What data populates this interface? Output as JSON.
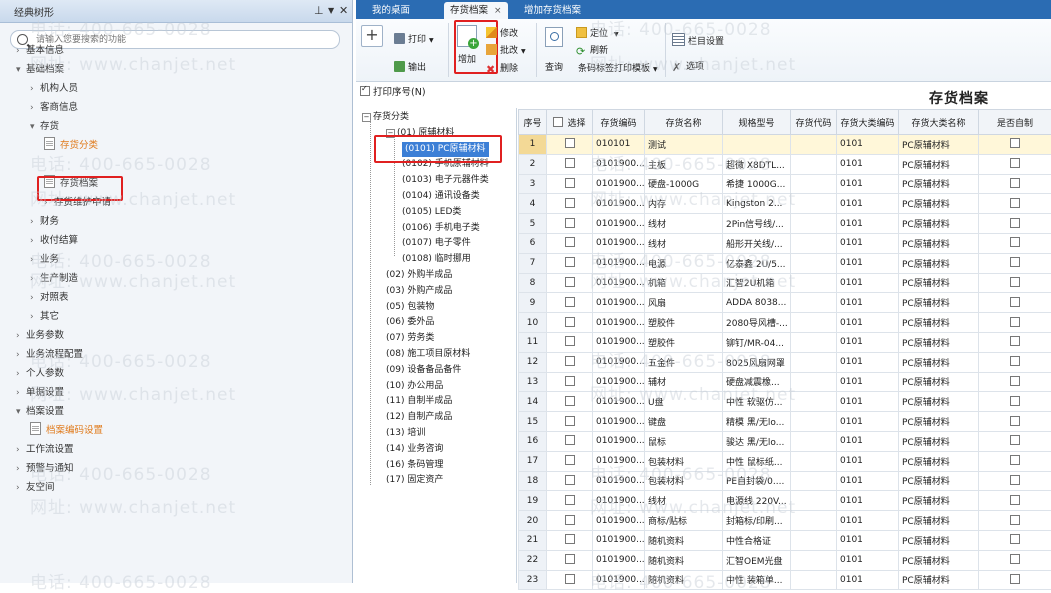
{
  "left_panel": {
    "title": "经典树形",
    "pin_icon": "pin-icon",
    "dropdown_icon": "chevron-down-icon",
    "close_icon": "close-icon",
    "search_placeholder": "请输入您要搜索的功能",
    "nav": [
      {
        "label": "基本信息",
        "state": "collapsed",
        "level": 0
      },
      {
        "label": "基础档案",
        "state": "expanded",
        "level": 0
      },
      {
        "label": "机构人员",
        "state": "collapsed",
        "level": 1
      },
      {
        "label": "客商信息",
        "state": "collapsed",
        "level": 1
      },
      {
        "label": "存货",
        "state": "expanded",
        "level": 1
      },
      {
        "label": "存货分类",
        "state": "leaf",
        "level": 2
      },
      {
        "label": "存货档案",
        "state": "leaf",
        "level": 2,
        "highlighted": true
      },
      {
        "label": "存货维护申请",
        "state": "collapsed",
        "level": 2
      },
      {
        "label": "财务",
        "state": "collapsed",
        "level": 1
      },
      {
        "label": "收付结算",
        "state": "collapsed",
        "level": 1
      },
      {
        "label": "业务",
        "state": "collapsed",
        "level": 1
      },
      {
        "label": "生产制造",
        "state": "collapsed",
        "level": 1
      },
      {
        "label": "对照表",
        "state": "collapsed",
        "level": 1
      },
      {
        "label": "其它",
        "state": "collapsed",
        "level": 1
      },
      {
        "label": "业务参数",
        "state": "collapsed",
        "level": 0
      },
      {
        "label": "业务流程配置",
        "state": "collapsed",
        "level": 0
      },
      {
        "label": "个人参数",
        "state": "collapsed",
        "level": 0
      },
      {
        "label": "单据设置",
        "state": "collapsed",
        "level": 0
      },
      {
        "label": "档案设置",
        "state": "expanded",
        "level": 0
      },
      {
        "label": "档案编码设置",
        "state": "leaf",
        "level": 1
      },
      {
        "label": "工作流设置",
        "state": "collapsed",
        "level": 0
      },
      {
        "label": "预警与通知",
        "state": "collapsed",
        "level": 0
      },
      {
        "label": "友空间",
        "state": "collapsed",
        "level": 0
      }
    ]
  },
  "tabs": [
    {
      "label": "我的桌面",
      "active": false
    },
    {
      "label": "存货档案",
      "active": true
    },
    {
      "label": "增加存货档案",
      "active": false
    }
  ],
  "tab_close": "×",
  "toolbar": {
    "add": "增加",
    "print": "打印",
    "output": "输出",
    "edit": "修改",
    "batch_change": "批改",
    "delete": "删除",
    "query": "查询",
    "locate": "定位",
    "refresh": "刷新",
    "barcode_print_template": "条码标签打印模板",
    "column_settings": "栏目设置",
    "options": "选项"
  },
  "print_seq_checkbox": {
    "label": "打印序号(N)",
    "checked": true
  },
  "page_title": "存货档案",
  "category_tree": [
    {
      "label": "存货分类",
      "level": 0
    },
    {
      "label": "(01) 原辅材料",
      "level": 1
    },
    {
      "label": "(0101) PC原辅材料",
      "level": 2,
      "selected": true
    },
    {
      "label": "(0102) 手机原辅材料",
      "level": 2
    },
    {
      "label": "(0103) 电子元器件类",
      "level": 2
    },
    {
      "label": "(0104) 通讯设备类",
      "level": 2
    },
    {
      "label": "(0105) LED类",
      "level": 2
    },
    {
      "label": "(0106) 手机电子类",
      "level": 2
    },
    {
      "label": "(0107) 电子零件",
      "level": 2
    },
    {
      "label": "(0108) 临时挪用",
      "level": 2
    },
    {
      "label": "(02) 外购半成品",
      "level": 1
    },
    {
      "label": "(03) 外购产成品",
      "level": 1
    },
    {
      "label": "(05) 包装物",
      "level": 1
    },
    {
      "label": "(06) 委外品",
      "level": 1
    },
    {
      "label": "(07) 劳务类",
      "level": 1
    },
    {
      "label": "(08) 施工项目原材料",
      "level": 1
    },
    {
      "label": "(09) 设备备品备件",
      "level": 1
    },
    {
      "label": "(10) 办公用品",
      "level": 1
    },
    {
      "label": "(11) 自制半成品",
      "level": 1
    },
    {
      "label": "(12) 自制产成品",
      "level": 1
    },
    {
      "label": "(13) 培训",
      "level": 1
    },
    {
      "label": "(14) 业务咨询",
      "level": 1
    },
    {
      "label": "(16) 条码管理",
      "level": 1
    },
    {
      "label": "(17) 固定资产",
      "level": 1
    }
  ],
  "grid": {
    "columns": [
      "序号",
      "选择",
      "存货编码",
      "存货名称",
      "规格型号",
      "存货代码",
      "存货大类编码",
      "存货大类名称",
      "是否自制"
    ],
    "rows": [
      [
        "1",
        "",
        "010101",
        "测试",
        "",
        "",
        "0101",
        "PC原辅材料",
        ""
      ],
      [
        "2",
        "",
        "0101900...",
        "主板",
        "超微 X8DTL...",
        "",
        "0101",
        "PC原辅材料",
        ""
      ],
      [
        "3",
        "",
        "0101900...",
        "硬盘-1000G",
        "希捷 1000G...",
        "",
        "0101",
        "PC原辅材料",
        ""
      ],
      [
        "4",
        "",
        "0101900...",
        "内存",
        "Kingston 2...",
        "",
        "0101",
        "PC原辅材料",
        ""
      ],
      [
        "5",
        "",
        "0101900...",
        "线材",
        "2Pin信号线/...",
        "",
        "0101",
        "PC原辅材料",
        ""
      ],
      [
        "6",
        "",
        "0101900...",
        "线材",
        "船形开关线/...",
        "",
        "0101",
        "PC原辅材料",
        ""
      ],
      [
        "7",
        "",
        "0101900...",
        "电源",
        "亿泰鑫 2U/5...",
        "",
        "0101",
        "PC原辅材料",
        ""
      ],
      [
        "8",
        "",
        "0101900...",
        "机箱",
        "汇智2U机箱",
        "",
        "0101",
        "PC原辅材料",
        ""
      ],
      [
        "9",
        "",
        "0101900...",
        "风扇",
        "ADDA 8038...",
        "",
        "0101",
        "PC原辅材料",
        ""
      ],
      [
        "10",
        "",
        "0101900...",
        "塑胶件",
        "2080导风槽-...",
        "",
        "0101",
        "PC原辅材料",
        ""
      ],
      [
        "11",
        "",
        "0101900...",
        "塑胶件",
        "铆钉/MR-04...",
        "",
        "0101",
        "PC原辅材料",
        ""
      ],
      [
        "12",
        "",
        "0101900...",
        "五金件",
        "8025风扇网罩",
        "",
        "0101",
        "PC原辅材料",
        ""
      ],
      [
        "13",
        "",
        "0101900...",
        "辅材",
        "硬盘减震橡...",
        "",
        "0101",
        "PC原辅材料",
        ""
      ],
      [
        "14",
        "",
        "0101900...",
        "U盘",
        "中性 软驱仿...",
        "",
        "0101",
        "PC原辅材料",
        ""
      ],
      [
        "15",
        "",
        "0101900...",
        "键盘",
        "精模 黑/无lo...",
        "",
        "0101",
        "PC原辅材料",
        ""
      ],
      [
        "16",
        "",
        "0101900...",
        "鼠标",
        "骏达 黑/无lo...",
        "",
        "0101",
        "PC原辅材料",
        ""
      ],
      [
        "17",
        "",
        "0101900...",
        "包装材料",
        "中性 鼠标纸...",
        "",
        "0101",
        "PC原辅材料",
        ""
      ],
      [
        "18",
        "",
        "0101900...",
        "包装材料",
        "PE自封袋/0....",
        "",
        "0101",
        "PC原辅材料",
        ""
      ],
      [
        "19",
        "",
        "0101900...",
        "线材",
        "电源线 220V...",
        "",
        "0101",
        "PC原辅材料",
        ""
      ],
      [
        "20",
        "",
        "0101900...",
        "商标/贴标",
        "封箱标/印刷...",
        "",
        "0101",
        "PC原辅材料",
        ""
      ],
      [
        "21",
        "",
        "0101900...",
        "随机资料",
        "中性合格证",
        "",
        "0101",
        "PC原辅材料",
        ""
      ],
      [
        "22",
        "",
        "0101900...",
        "随机资料",
        "汇智OEM光盘",
        "",
        "0101",
        "PC原辅材料",
        ""
      ],
      [
        "23",
        "",
        "0101900...",
        "随机资料",
        "中性 装箱单...",
        "",
        "0101",
        "PC原辅材料",
        ""
      ]
    ]
  },
  "watermarks": {
    "phone": "电话: 400-665-0028",
    "site": "网址: www.chanjet.net"
  },
  "colors": {
    "tab_bar": "#2b6cb3",
    "highlight_box": "#e02020",
    "selected_tree": "#3c7fd6",
    "orange_text": "#e07a1b"
  }
}
